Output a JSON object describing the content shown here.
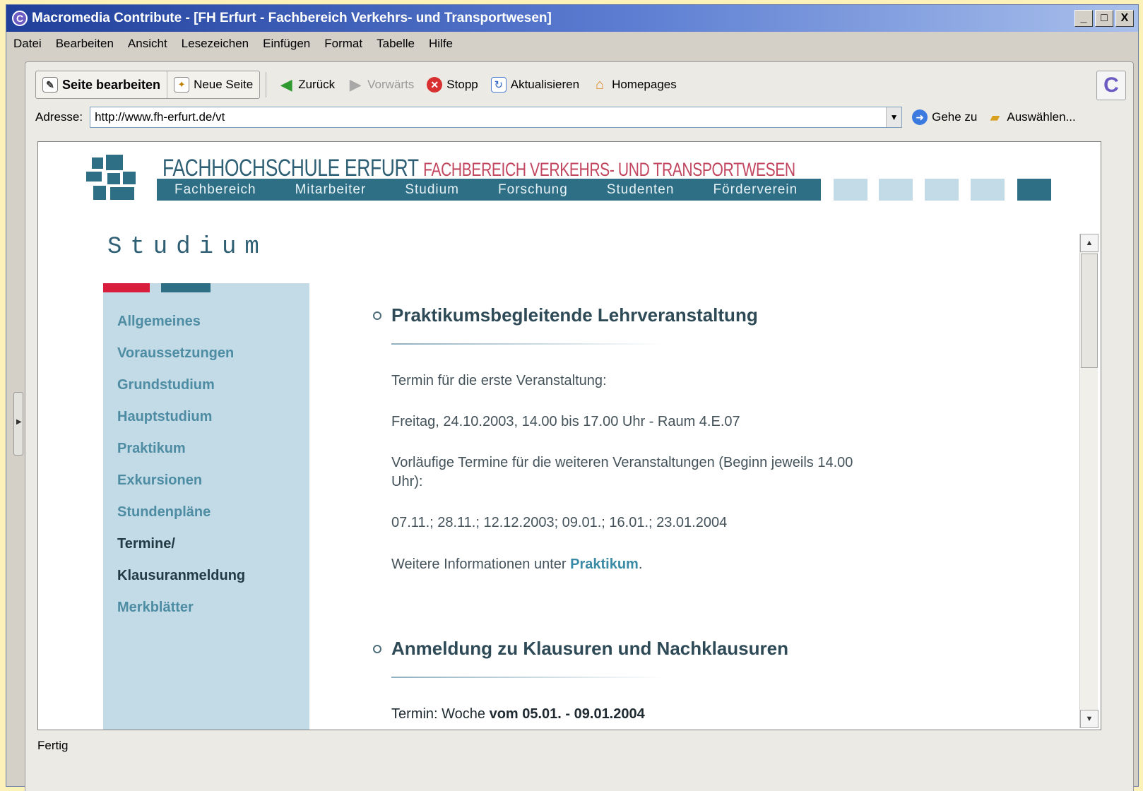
{
  "window": {
    "title": "Macromedia Contribute - [FH Erfurt - Fachbereich Verkehrs- und Transportwesen]",
    "controls": [
      "_",
      "□",
      "X"
    ]
  },
  "menu": [
    "Datei",
    "Bearbeiten",
    "Ansicht",
    "Lesezeichen",
    "Einfügen",
    "Format",
    "Tabelle",
    "Hilfe"
  ],
  "toolbar": {
    "edit_page": "Seite bearbeiten",
    "new_page": "Neue Seite",
    "back": "Zurück",
    "forward": "Vorwärts",
    "stop": "Stopp",
    "refresh": "Aktualisieren",
    "homepages": "Homepages"
  },
  "address": {
    "label": "Adresse:",
    "value": "http://www.fh-erfurt.de/vt",
    "go": "Gehe zu",
    "choose": "Auswählen..."
  },
  "site": {
    "school": "FACHHOCHSCHULE ERFURT",
    "department": "FACHBEREICH VERKEHRS- UND TRANSPORTWESEN",
    "topnav": [
      "Fachbereich",
      "Mitarbeiter",
      "Studium",
      "Forschung",
      "Studenten",
      "Förderverein"
    ],
    "page_heading": "Studium",
    "sidebar": [
      "Allgemeines",
      "Voraussetzungen",
      "Grundstudium",
      "Hauptstudium",
      "Praktikum",
      "Exkursionen",
      "Stundenpläne",
      "Termine/",
      "Klausuranmeldung",
      "Merkblätter"
    ],
    "section1": {
      "title": "Praktikumsbegleitende Lehrveranstaltung",
      "p1": "Termin für die erste Veranstaltung:",
      "p2": "Freitag, 24.10.2003, 14.00 bis 17.00 Uhr - Raum 4.E.07",
      "p3": "Vorläufige Termine für die weiteren Veranstaltungen (Beginn jeweils 14.00 Uhr):",
      "p4": "07.11.; 28.11.; 12.12.2003; 09.01.; 16.01.; 23.01.2004",
      "p5_prefix": "Weitere Informationen unter",
      "p5_link": "Praktikum",
      "p5_suffix": "."
    },
    "section2": {
      "title": "Anmeldung zu Klausuren und Nachklausuren",
      "p1_prefix": "Termin: Woche",
      "p1_bold": "vom 05.01. - 09.01.2004"
    }
  },
  "status": "Fertig"
}
